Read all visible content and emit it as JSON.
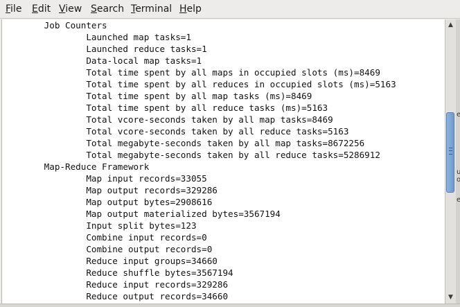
{
  "menubar": {
    "items": [
      {
        "mnemonic": "F",
        "rest": "ile"
      },
      {
        "mnemonic": "E",
        "rest": "dit"
      },
      {
        "mnemonic": "V",
        "rest": "iew"
      },
      {
        "mnemonic": "S",
        "rest": "earch"
      },
      {
        "mnemonic": "T",
        "rest": "erminal"
      },
      {
        "mnemonic": "H",
        "rest": "elp"
      }
    ]
  },
  "terminal": {
    "lines": [
      "        Job Counters ",
      "                Launched map tasks=1",
      "                Launched reduce tasks=1",
      "                Data-local map tasks=1",
      "                Total time spent by all maps in occupied slots (ms)=8469",
      "                Total time spent by all reduces in occupied slots (ms)=5163",
      "                Total time spent by all map tasks (ms)=8469",
      "                Total time spent by all reduce tasks (ms)=5163",
      "                Total vcore-seconds taken by all map tasks=8469",
      "                Total vcore-seconds taken by all reduce tasks=5163",
      "                Total megabyte-seconds taken by all map tasks=8672256",
      "                Total megabyte-seconds taken by all reduce tasks=5286912",
      "        Map-Reduce Framework",
      "                Map input records=33055",
      "                Map output records=329286",
      "                Map output bytes=2908616",
      "                Map output materialized bytes=3567194",
      "                Input split bytes=123",
      "                Combine input records=0",
      "                Combine output records=0",
      "                Reduce input groups=34660",
      "                Reduce shuffle bytes=3567194",
      "                Reduce input records=329286",
      "                Reduce output records=34660"
    ]
  },
  "scrollbar": {
    "up_glyph": "▲",
    "down_glyph": "▼",
    "position_fraction": 0.45
  },
  "edge_fragments": [
    "e",
    "u",
    "o",
    "e"
  ]
}
